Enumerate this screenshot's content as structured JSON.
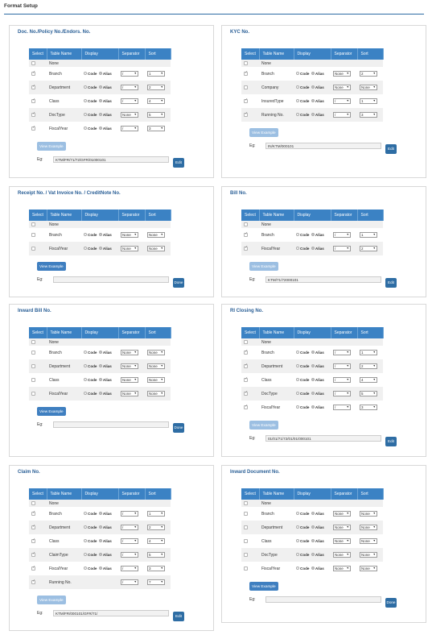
{
  "page_title": "Format Setup",
  "columns": [
    "Select",
    "Table Name",
    "Display",
    "Separator",
    "Sort"
  ],
  "none_label": "None",
  "code_label": "Code",
  "alias_label": "Alias",
  "panels": [
    {
      "title": "Doc. No./Policy No./Endors. No.",
      "rows": [
        {
          "checked": true,
          "name": "Branch",
          "display": "alias",
          "sep": "/",
          "sort": "1"
        },
        {
          "checked": true,
          "name": "Department",
          "display": "alias",
          "sep": "/",
          "sort": "2"
        },
        {
          "checked": true,
          "name": "Class",
          "display": "alias",
          "sep": "/",
          "sort": "4"
        },
        {
          "checked": true,
          "name": "DocType",
          "display": "alias",
          "sep": "None",
          "sort": "5"
        },
        {
          "checked": true,
          "name": "FiscalYear",
          "display": "alias",
          "sep": "/",
          "sort": "3"
        }
      ],
      "example_label": "View Example",
      "example_disabled": true,
      "eg_label": "Eg:",
      "eg_value": "KTM/FR/71/72/GFR/01000101",
      "action_label": "Edit"
    },
    {
      "title": "KYC No.",
      "rows": [
        {
          "checked": true,
          "name": "Branch",
          "display": "alias",
          "sep": "None",
          "sort": "2"
        },
        {
          "checked": false,
          "name": "Company",
          "display": "alias",
          "sep": "None",
          "sort": "None"
        },
        {
          "checked": true,
          "name": "InsuredType",
          "display": "alias",
          "sep": "/",
          "sort": "1"
        },
        {
          "checked": true,
          "name": "Running No.",
          "display": "alias",
          "sep": "/",
          "sort": "3"
        }
      ],
      "example_label": "View Example",
      "example_disabled": true,
      "eg_label": "Eg:",
      "eg_value": "IN/KTM/000101",
      "action_label": "Edit"
    },
    {
      "title": "Receipt No. / Vat Invoice No. / CreditNote No.",
      "rows": [
        {
          "checked": false,
          "name": "Branch",
          "display": "alias",
          "sep": "None",
          "sort": "None"
        },
        {
          "checked": false,
          "name": "FiscalYear",
          "display": "alias",
          "sep": "None",
          "sort": "None"
        }
      ],
      "example_label": "View Example",
      "example_disabled": false,
      "eg_label": "Eg:",
      "eg_value": "",
      "action_label": "Done"
    },
    {
      "title": "Bill No.",
      "rows": [
        {
          "checked": true,
          "name": "Branch",
          "display": "alias",
          "sep": "/",
          "sort": "1"
        },
        {
          "checked": true,
          "name": "FiscalYear",
          "display": "alias",
          "sep": "/",
          "sort": "2"
        }
      ],
      "example_label": "View Example",
      "example_disabled": true,
      "eg_label": "Eg:",
      "eg_value": "KTM/71/72000101",
      "action_label": "Edit"
    },
    {
      "title": "Inward Bill No.",
      "rows": [
        {
          "checked": false,
          "name": "Branch",
          "display": "alias",
          "sep": "None",
          "sort": "None"
        },
        {
          "checked": false,
          "name": "Department",
          "display": "alias",
          "sep": "None",
          "sort": "None"
        },
        {
          "checked": false,
          "name": "Class",
          "display": "alias",
          "sep": "None",
          "sort": "None"
        },
        {
          "checked": false,
          "name": "FiscalYear",
          "display": "alias",
          "sep": "None",
          "sort": "None"
        }
      ],
      "example_label": "View Example",
      "example_disabled": false,
      "eg_label": "Eg:",
      "eg_value": "",
      "action_label": "Done"
    },
    {
      "title": "RI Closing No.",
      "rows": [
        {
          "checked": true,
          "name": "Branch",
          "display": "alias",
          "sep": "/",
          "sort": "1"
        },
        {
          "checked": true,
          "name": "Department",
          "display": "alias",
          "sep": "/",
          "sort": "2"
        },
        {
          "checked": true,
          "name": "Class",
          "display": "alias",
          "sep": "/",
          "sort": "4"
        },
        {
          "checked": true,
          "name": "DocType",
          "display": "alias",
          "sep": "/",
          "sort": "5"
        },
        {
          "checked": true,
          "name": "FiscalYear",
          "display": "alias",
          "sep": "/",
          "sort": "3"
        }
      ],
      "example_label": "View Example",
      "example_disabled": true,
      "eg_label": "Eg:",
      "eg_value": "01/01/71/72/01/01/000101",
      "action_label": "Edit"
    },
    {
      "title": "Claim No.",
      "rows": [
        {
          "checked": true,
          "name": "Branch",
          "display": "alias",
          "sep": "/",
          "sort": "1"
        },
        {
          "checked": true,
          "name": "Department",
          "display": "alias",
          "sep": "/",
          "sort": "2"
        },
        {
          "checked": true,
          "name": "Class",
          "display": "alias",
          "sep": "/",
          "sort": "4"
        },
        {
          "checked": true,
          "name": "ClaimType",
          "display": "alias",
          "sep": "/",
          "sort": "5"
        },
        {
          "checked": true,
          "name": "FiscalYear",
          "display": "alias",
          "sep": "/",
          "sort": "3"
        },
        {
          "checked": true,
          "name": "Running No.",
          "display": "",
          "sep": "/",
          "sort": "7"
        }
      ],
      "example_label": "View Example",
      "example_disabled": true,
      "eg_label": "Eg:",
      "eg_value": "KTM/FR/000101/GFR/71/",
      "action_label": "Edit"
    },
    {
      "title": "Inward Document No.",
      "rows": [
        {
          "checked": false,
          "name": "Branch",
          "display": "alias",
          "sep": "None",
          "sort": "None"
        },
        {
          "checked": false,
          "name": "Department",
          "display": "alias",
          "sep": "None",
          "sort": "None"
        },
        {
          "checked": false,
          "name": "Class",
          "display": "alias",
          "sep": "None",
          "sort": "None"
        },
        {
          "checked": false,
          "name": "DocType",
          "display": "alias",
          "sep": "None",
          "sort": "None"
        },
        {
          "checked": false,
          "name": "FiscalYear",
          "display": "alias",
          "sep": "None",
          "sort": "None"
        }
      ],
      "example_label": "View Example",
      "example_disabled": false,
      "eg_label": "Eg:",
      "eg_value": "",
      "action_label": "Done"
    }
  ]
}
